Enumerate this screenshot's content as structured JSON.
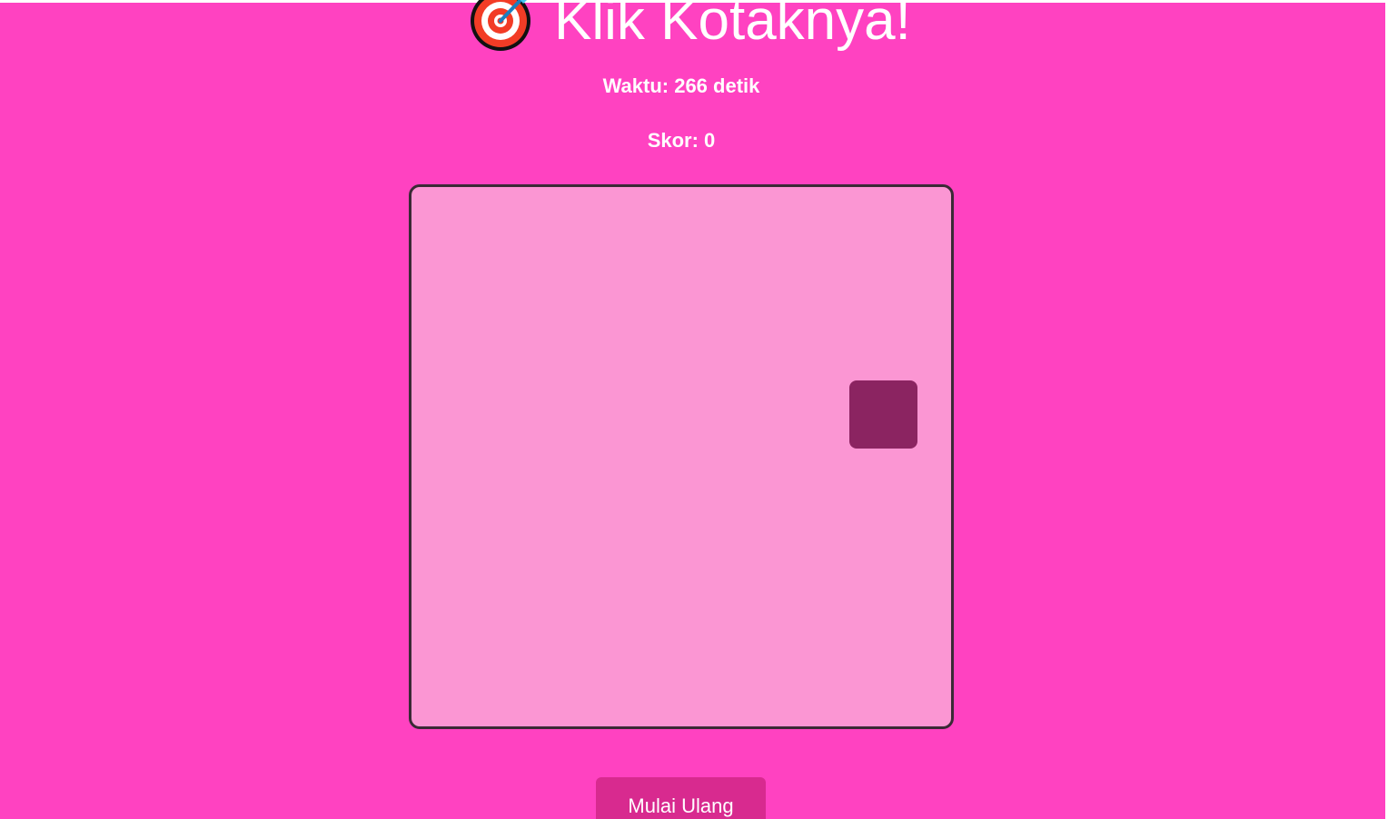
{
  "title": "Klik Kotaknya!",
  "title_icon": "direct-hit-target-icon",
  "stats": {
    "time_text": "Waktu: 266 detik",
    "score_text": "Skor: 0"
  },
  "game": {
    "target_box_color": "#8b2461"
  },
  "controls": {
    "restart_label": "Mulai Ulang",
    "restart_color": "#d82a8f"
  },
  "colors": {
    "background": "#ff42c1",
    "board": "#fb96d3",
    "board_border": "#3a2a35",
    "text": "#ffffff"
  }
}
